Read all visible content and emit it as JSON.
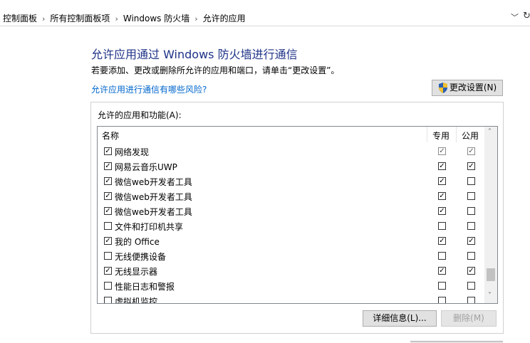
{
  "breadcrumb": {
    "items": [
      "控制面板",
      "所有控制面板项",
      "Windows 防火墙",
      "允许的应用"
    ],
    "separator": "›",
    "dropdown_glyph": "﹀",
    "refresh_glyph": "↻"
  },
  "page": {
    "heading": "允许应用通过 Windows 防火墙进行通信",
    "subtext": "若要添加、更改或删除所允许的应用和端口，请单击“更改设置”。",
    "risk_link": "允许应用进行通信有哪些风险?",
    "change_settings_label": "更改设置(N)",
    "change_settings_icon": "uac-shield-icon"
  },
  "group": {
    "label": "允许的应用和功能(A):",
    "columns": {
      "name": "名称",
      "private": "专用",
      "public": "公用"
    },
    "rows": [
      {
        "name": "网络发现",
        "enabled": true,
        "private": true,
        "public": true,
        "dim": true
      },
      {
        "name": "网易云音乐UWP",
        "enabled": true,
        "private": true,
        "public": true,
        "dim": false
      },
      {
        "name": "微信web开发者工具",
        "enabled": true,
        "private": true,
        "public": false,
        "dim": false
      },
      {
        "name": "微信web开发者工具",
        "enabled": true,
        "private": true,
        "public": false,
        "dim": false
      },
      {
        "name": "微信web开发者工具",
        "enabled": true,
        "private": true,
        "public": false,
        "dim": false
      },
      {
        "name": "文件和打印机共享",
        "enabled": false,
        "private": false,
        "public": false,
        "dim": false
      },
      {
        "name": "我的 Office",
        "enabled": true,
        "private": true,
        "public": true,
        "dim": false
      },
      {
        "name": "无线便携设备",
        "enabled": false,
        "private": false,
        "public": false,
        "dim": false
      },
      {
        "name": "无线显示器",
        "enabled": true,
        "private": true,
        "public": true,
        "dim": false
      },
      {
        "name": "性能日志和警报",
        "enabled": false,
        "private": false,
        "public": false,
        "dim": false
      },
      {
        "name": "虚拟机监控",
        "enabled": false,
        "private": false,
        "public": false,
        "dim": false
      }
    ],
    "check_glyph": "✓",
    "scroll_up_glyph": "˄",
    "scroll_down_glyph": "˅",
    "details_label": "详细信息(L)...",
    "delete_label": "删除(M)"
  }
}
